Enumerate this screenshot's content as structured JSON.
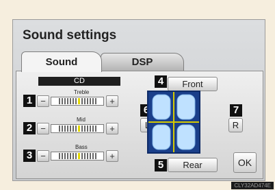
{
  "title": "Sound settings",
  "tabs": [
    {
      "label": "Sound"
    },
    {
      "label": "DSP"
    }
  ],
  "source": "CD",
  "tone": [
    {
      "num": "1",
      "label": "Treble",
      "minus": "−",
      "plus": "+",
      "level": 0.5
    },
    {
      "num": "2",
      "label": "Mid",
      "minus": "−",
      "plus": "+",
      "level": 0.5
    },
    {
      "num": "3",
      "label": "Bass",
      "minus": "−",
      "plus": "+",
      "level": 0.5
    }
  ],
  "balance": {
    "front": {
      "num": "4",
      "label": "Front"
    },
    "rear": {
      "num": "5",
      "label": "Rear"
    },
    "left": {
      "num": "6",
      "label": "L"
    },
    "right": {
      "num": "7",
      "label": "R"
    }
  },
  "ok_label": "OK",
  "watermark": "CLY32AD474E"
}
